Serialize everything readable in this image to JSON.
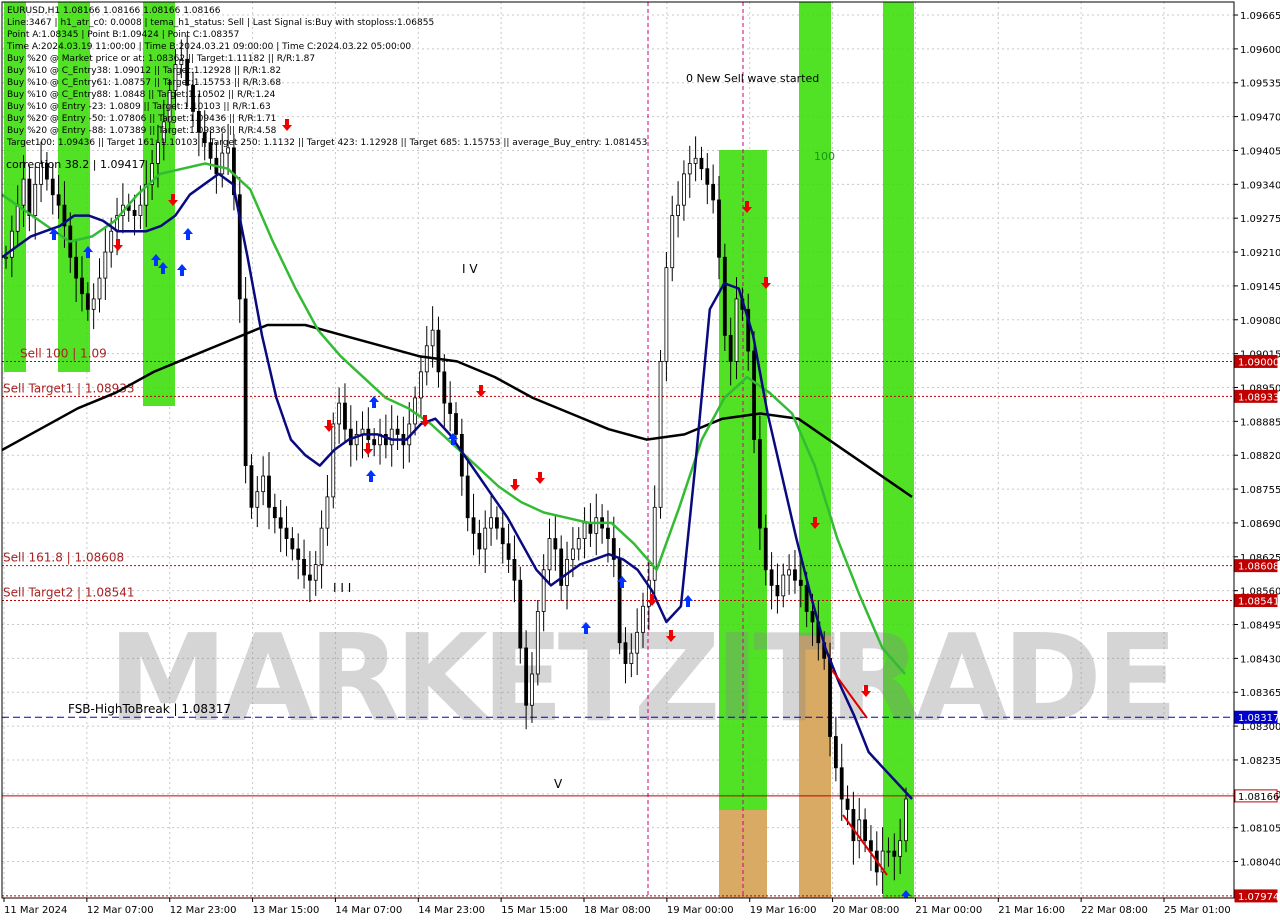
{
  "header": {
    "lines": [
      "EURUSD,H1  1.08166 1.08166 1.08166 1.08166",
      "Line:3467  |  h1_atr_c0: 0.0008  |  tema_h1_status: Sell  |  Last Signal is:Buy with stoploss:1.06855",
      "Point A:1.08345  |  Point B:1.09424  |  Point C:1.08357",
      "Time A:2024.03.19 11:00:00  |  Time B:2024.03.21 09:00:00  |  Time C:2024.03.22 05:00:00",
      "Buy %20 @ Market price or at: 1.08362  ||  Target:1.11182  ||  R/R:1.87",
      "Buy %10 @ C_Entry38: 1.09012  ||  Target:1.12928  ||  R/R:1.82",
      "Buy %10 @ C_Entry61: 1.08757  ||  Target:1.15753  ||  R/R:3.68",
      "Buy %10 @ C_Entry88: 1.0848  ||  Target:1.10502  ||  R/R:1.24",
      "Buy %10 @ Entry -23: 1.0809  ||  Target:1.10103  ||  R/R:1.63",
      "Buy %20 @ Entry -50: 1.07806  ||  Target:1.09436  ||  R/R:1.71",
      "Buy %20 @ Entry -88: 1.07389  ||  Target:1.09836  ||  R/R:4.58",
      "Target100: 1.09436  ||  Target 161: 1.10103  ||  Target 250: 1.1132  ||  Target 423: 1.12928  ||  Target 685: 1.15753  ||  average_Buy_entry: 1.081453"
    ],
    "correction_label": "correction 38.2 | 1.09417",
    "wave_text": "0 New Sell wave started",
    "wave_labels": [
      "I V",
      "I I I",
      "V"
    ],
    "percent_label": "100"
  },
  "watermark": "MARKETZITRADE",
  "colors": {
    "background": "#ffffff",
    "grid": "#c8c8c8",
    "green_zone": "#33dd00",
    "orange_zone": "#f0a070",
    "candles": "#000000",
    "ema_dark_blue": "#0a0a80",
    "ema_green": "#33bb33",
    "sma_black": "#000000",
    "level_red": "#c00000",
    "level_blue": "#0000cc",
    "arrow_buy": "#0033ff",
    "arrow_sell": "#ee0000"
  },
  "chart_data": {
    "type": "candlestick",
    "symbol": "EURUSD",
    "timeframe": "H1",
    "ylim": [
      1.0797,
      1.0969
    ],
    "y_ticks": [
      1.0796,
      1.0804,
      1.08105,
      1.0817,
      1.08235,
      1.083,
      1.08365,
      1.0843,
      1.08495,
      1.0856,
      1.08625,
      1.0869,
      1.08755,
      1.0882,
      1.08885,
      1.0895,
      1.09015,
      1.0908,
      1.09145,
      1.0921,
      1.09275,
      1.0934,
      1.09405,
      1.0947,
      1.09535,
      1.096,
      1.09665
    ],
    "y_tick_labels": [
      "1.0796",
      "1.08040",
      "1.08105",
      "1.08170",
      "1.08235",
      "1.08300",
      "1.08365",
      "1.08430",
      "1.08495",
      "1.08560",
      "1.08625",
      "1.08690",
      "1.08755",
      "1.08820",
      "1.08885",
      "1.08950",
      "1.09015",
      "1.09080",
      "1.09145",
      "1.09210",
      "1.09275",
      "1.09340",
      "1.09405",
      "1.09470",
      "1.09535",
      "1.09600",
      "1.09665"
    ],
    "x_labels": [
      "11 Mar 2024",
      "12 Mar 07:00",
      "12 Mar 23:00",
      "13 Mar 15:00",
      "14 Mar 07:00",
      "14 Mar 23:00",
      "15 Mar 15:00",
      "18 Mar 08:00",
      "19 Mar 00:00",
      "19 Mar 16:00",
      "20 Mar 08:00",
      "21 Mar 00:00",
      "21 Mar 16:00",
      "22 Mar 08:00",
      "25 Mar 01:00"
    ],
    "levels": [
      {
        "name": "Sell 100",
        "label": "Sell 100 | 1.09",
        "value": 1.09,
        "price_tag": "1.09000",
        "style": "dotted",
        "color": "#c00000"
      },
      {
        "name": "Sell Target1",
        "label": "Sell Target1 | 1.08933",
        "value": 1.08933,
        "price_tag": "1.08933",
        "style": "dotted",
        "color": "#c00000"
      },
      {
        "name": "Sell 161.8",
        "label": "Sell 161.8 | 1.08608",
        "value": 1.08608,
        "price_tag": "1.08608",
        "style": "dotted",
        "color": "#c00000"
      },
      {
        "name": "Sell Target2",
        "label": "Sell Target2 | 1.08541",
        "value": 1.08541,
        "price_tag": "1.08541",
        "style": "dotted",
        "color": "#c00000"
      },
      {
        "name": "FSB-HighToBreak",
        "label": "FSB-HighToBreak | 1.08317",
        "value": 1.08317,
        "price_tag": "1.08317",
        "style": "dashed",
        "color": "#0000cc"
      },
      {
        "name": "Current",
        "label": "",
        "value": 1.08166,
        "price_tag": "1.08166",
        "style": "solid",
        "color": "#c00000"
      },
      {
        "name": "Bottom",
        "label": "",
        "value": 1.07974,
        "price_tag": "1.07974",
        "style": "dotted",
        "color": "#c00000"
      }
    ],
    "close_series": [
      1.092,
      1.0925,
      1.093,
      1.0935,
      1.0928,
      1.0934,
      1.0938,
      1.0935,
      1.0932,
      1.093,
      1.0926,
      1.092,
      1.0916,
      1.0913,
      1.091,
      1.0912,
      1.0916,
      1.0921,
      1.0925,
      1.0928,
      1.093,
      1.0929,
      1.0928,
      1.093,
      1.0934,
      1.0938,
      1.0942,
      1.0946,
      1.0952,
      1.0957,
      1.0958,
      1.0953,
      1.0948,
      1.0944,
      1.0942,
      1.0939,
      1.0936,
      1.094,
      1.0941,
      1.0932,
      1.0912,
      1.088,
      1.0872,
      1.0875,
      1.0878,
      1.0872,
      1.087,
      1.0868,
      1.0866,
      1.0864,
      1.0862,
      1.0859,
      1.0858,
      1.0861,
      1.0868,
      1.0874,
      1.0888,
      1.0892,
      1.0887,
      1.0884,
      1.0886,
      1.0887,
      1.0885,
      1.0884,
      1.0886,
      1.0884,
      1.0887,
      1.0886,
      1.0884,
      1.0888,
      1.0893,
      1.0898,
      1.0903,
      1.0906,
      1.0898,
      1.0892,
      1.089,
      1.0886,
      1.0878,
      1.087,
      1.0867,
      1.0864,
      1.0868,
      1.087,
      1.0868,
      1.0865,
      1.0862,
      1.0858,
      1.0845,
      1.0834,
      1.084,
      1.0852,
      1.086,
      1.0866,
      1.0864,
      1.0857,
      1.0862,
      1.0864,
      1.0866,
      1.0869,
      1.0867,
      1.087,
      1.0868,
      1.0866,
      1.0862,
      1.0846,
      1.0842,
      1.0844,
      1.0848,
      1.0853,
      1.0858,
      1.0872,
      1.09,
      1.0918,
      1.0928,
      1.093,
      1.0936,
      1.0938,
      1.0939,
      1.0937,
      1.0934,
      1.0931,
      1.092,
      1.0905,
      1.09,
      1.0912,
      1.091,
      1.0902,
      1.0885,
      1.0868,
      1.086,
      1.0857,
      1.0855,
      1.0859,
      1.086,
      1.0858,
      1.0857,
      1.0852,
      1.085,
      1.0846,
      1.0843,
      1.0828,
      1.0822,
      1.0816,
      1.0814,
      1.0808,
      1.0812,
      1.0808,
      1.0806,
      1.0802,
      1.0806,
      1.0806,
      1.0805,
      1.0808,
      1.0816
    ],
    "ema_dark_blue": [
      1.092,
      1.0922,
      1.0924,
      1.0925,
      1.0926,
      1.0928,
      1.0928,
      1.0927,
      1.0925,
      1.0925,
      1.0925,
      1.0926,
      1.0928,
      1.0932,
      1.0934,
      1.0936,
      1.0934,
      1.092,
      1.0905,
      1.0893,
      1.0885,
      1.0882,
      1.088,
      1.0883,
      1.0885,
      1.0886,
      1.0886,
      1.0885,
      1.0885,
      1.0888,
      1.0889,
      1.0886,
      1.0882,
      1.0878,
      1.0874,
      1.087,
      1.0865,
      1.086,
      1.0857,
      1.0859,
      1.0861,
      1.0862,
      1.0863,
      1.0862,
      1.086,
      1.0856,
      1.085,
      1.0853,
      1.088,
      1.091,
      1.0915,
      1.0914,
      1.0905,
      1.089,
      1.0878,
      1.0866,
      1.0855,
      1.0845,
      1.0838,
      1.0832,
      1.0825,
      1.0822,
      1.0819,
      1.0816
    ],
    "ema_green": [
      1.0932,
      1.0929,
      1.0926,
      1.0923,
      1.0924,
      1.0927,
      1.0932,
      1.0936,
      1.0937,
      1.0938,
      1.0937,
      1.0933,
      1.0923,
      1.0914,
      1.0906,
      1.0901,
      1.0897,
      1.0893,
      1.0891,
      1.0888,
      1.0884,
      1.088,
      1.0876,
      1.0873,
      1.0871,
      1.087,
      1.0869,
      1.0869,
      1.0865,
      1.086,
      1.0872,
      1.0885,
      1.0893,
      1.0897,
      1.0894,
      1.089,
      1.088,
      1.0866,
      1.0855,
      1.0845,
      1.084
    ],
    "sma_black": [
      1.0883,
      1.0887,
      1.0891,
      1.0894,
      1.0898,
      1.0901,
      1.0904,
      1.0907,
      1.0907,
      1.0905,
      1.0903,
      1.0901,
      1.09,
      1.0897,
      1.0893,
      1.089,
      1.0887,
      1.0885,
      1.0886,
      1.0889,
      1.089,
      1.0889,
      1.0884,
      1.0879,
      1.0874
    ],
    "vertical_markers": [
      {
        "label": "19 Mar 00:00",
        "style": "dashed_magenta"
      },
      {
        "label": "21 Mar 00:00",
        "style": "dashed_magenta"
      }
    ]
  }
}
